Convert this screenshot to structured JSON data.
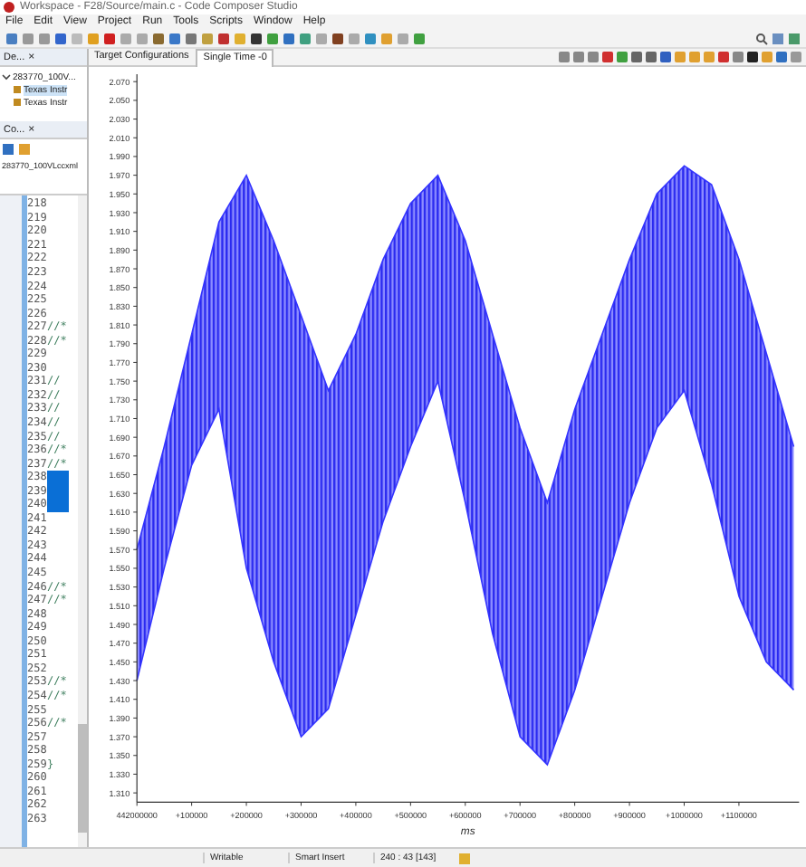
{
  "window": {
    "title": "Workspace - F28/Source/main.c - Code Composer Studio"
  },
  "menu": [
    "File",
    "Edit",
    "View",
    "Project",
    "Run",
    "Tools",
    "Scripts",
    "Window",
    "Help"
  ],
  "left_tab": {
    "label": "De...",
    "close": "×"
  },
  "tabs": [
    {
      "label": "Target Configurations",
      "selected": false
    },
    {
      "label": "Single Time -0",
      "selected": true
    }
  ],
  "debug_tree": [
    {
      "label": "283770_100V...",
      "expanded": true,
      "children": [
        {
          "label": "Texas Instr",
          "selected": true
        },
        {
          "label": "Texas Instr",
          "selected": false
        }
      ]
    }
  ],
  "console_panel": {
    "tab": "Co...",
    "close": "×",
    "text": "283770_100VLccxml"
  },
  "editor": {
    "lines": [
      {
        "number": "218",
        "selected": false
      },
      {
        "number": "219",
        "selected": false
      },
      {
        "number": "220",
        "selected": false
      },
      {
        "number": "221",
        "selected": false
      },
      {
        "number": "222",
        "selected": false
      },
      {
        "number": "223",
        "selected": false
      },
      {
        "number": "224",
        "selected": false
      },
      {
        "number": "225",
        "selected": false
      },
      {
        "number": "226",
        "selected": false
      },
      {
        "number": "227",
        "code": "//*",
        "selected": false
      },
      {
        "number": "228",
        "code": "//*",
        "selected": false
      },
      {
        "number": "229",
        "selected": false
      },
      {
        "number": "230",
        "selected": false
      },
      {
        "number": "231",
        "code": "//",
        "selected": false
      },
      {
        "number": "232",
        "code": "//",
        "selected": false
      },
      {
        "number": "233",
        "code": "//",
        "selected": false
      },
      {
        "number": "234",
        "code": "//",
        "selected": false
      },
      {
        "number": "235",
        "code": "//",
        "selected": false
      },
      {
        "number": "236",
        "code": "//*",
        "selected": false
      },
      {
        "number": "237",
        "code": "//*",
        "selected": false
      },
      {
        "number": "238",
        "selected": true
      },
      {
        "number": "239",
        "selected": true
      },
      {
        "number": "240",
        "selected": true
      },
      {
        "number": "241",
        "selected": false
      },
      {
        "number": "242",
        "selected": false
      },
      {
        "number": "243",
        "selected": false
      },
      {
        "number": "244",
        "selected": false
      },
      {
        "number": "245",
        "selected": false
      },
      {
        "number": "246",
        "code": "//*",
        "selected": false
      },
      {
        "number": "247",
        "code": "//*",
        "selected": false
      },
      {
        "number": "248",
        "selected": false
      },
      {
        "number": "249",
        "selected": false
      },
      {
        "number": "250",
        "selected": false
      },
      {
        "number": "251",
        "selected": false
      },
      {
        "number": "252",
        "selected": false
      },
      {
        "number": "253",
        "code": "//*",
        "selected": false
      },
      {
        "number": "254",
        "code": "//*",
        "selected": false
      },
      {
        "number": "255",
        "selected": false
      },
      {
        "number": "256",
        "code": "//*",
        "selected": false
      },
      {
        "number": "257",
        "selected": false
      },
      {
        "number": "258",
        "selected": false
      },
      {
        "number": "259",
        "code": "}",
        "selected": false
      },
      {
        "number": "260",
        "selected": false
      },
      {
        "number": "261",
        "selected": false
      },
      {
        "number": "262",
        "selected": false
      },
      {
        "number": "263",
        "selected": false
      }
    ]
  },
  "chart": {
    "chart_data": {
      "type": "area",
      "xlabel": "ms",
      "categories": [
        "442000000",
        null,
        "+100000",
        null,
        "+200000",
        null,
        "+300000",
        null,
        "+400000",
        null,
        "+500000",
        null,
        "+600000",
        null,
        "+700000",
        null,
        "+800000",
        null,
        "+900000",
        null,
        "+1000000",
        null,
        "+1100000",
        null,
        null
      ],
      "series": [
        {
          "color": "#3333ff",
          "values": [
            1.57,
            1.68,
            1.8,
            1.92,
            1.97,
            1.9,
            1.82,
            1.74,
            1.8,
            1.88,
            1.94,
            1.97,
            1.9,
            1.8,
            1.7,
            1.62,
            1.72,
            1.8,
            1.88,
            1.95,
            1.98,
            1.96,
            1.88,
            1.78,
            1.68
          ]
        },
        {
          "type": "line",
          "color": "#3333ff",
          "values": [
            1.43,
            1.55,
            1.66,
            1.72,
            1.55,
            1.45,
            1.37,
            1.4,
            1.5,
            1.6,
            1.68,
            1.75,
            1.62,
            1.48,
            1.37,
            1.34,
            1.42,
            1.52,
            1.62,
            1.7,
            1.74,
            1.64,
            1.52,
            1.45,
            1.42
          ]
        }
      ],
      "ylim": [
        1.3,
        2.078
      ],
      "yticks": [
        {
          "value": 1.31,
          "label": "1.310"
        },
        {
          "value": 1.33,
          "label": "1.330"
        },
        {
          "value": 1.35,
          "label": "1.350"
        },
        {
          "value": 1.37,
          "label": "1.370"
        },
        {
          "value": 1.39,
          "label": "1.390"
        },
        {
          "value": 1.41,
          "label": "1.410"
        },
        {
          "value": 1.43,
          "label": "1.430"
        },
        {
          "value": 1.45,
          "label": "1.450"
        },
        {
          "value": 1.47,
          "label": "1.470"
        },
        {
          "value": 1.49,
          "label": "1.490"
        },
        {
          "value": 1.51,
          "label": "1.510"
        },
        {
          "value": 1.53,
          "label": "1.530"
        },
        {
          "value": 1.55,
          "label": "1.550"
        },
        {
          "value": 1.57,
          "label": "1.570"
        },
        {
          "value": 1.59,
          "label": "1.590"
        },
        {
          "value": 1.61,
          "label": "1.610"
        },
        {
          "value": 1.63,
          "label": "1.630"
        },
        {
          "value": 1.65,
          "label": "1.650"
        },
        {
          "value": 1.67,
          "label": "1.670"
        },
        {
          "value": 1.69,
          "label": "1.690"
        },
        {
          "value": 1.71,
          "label": "1.710"
        },
        {
          "value": 1.73,
          "label": "1.730"
        },
        {
          "value": 1.75,
          "label": "1.750"
        },
        {
          "value": 1.77,
          "label": "1.770"
        },
        {
          "value": 1.79,
          "label": "1.790"
        },
        {
          "value": 1.81,
          "label": "1.810"
        },
        {
          "value": 1.83,
          "label": "1.830"
        },
        {
          "value": 1.85,
          "label": "1.850"
        },
        {
          "value": 1.87,
          "label": "1.870"
        },
        {
          "value": 1.89,
          "label": "1.890"
        },
        {
          "value": 1.91,
          "label": "1.910"
        },
        {
          "value": 1.93,
          "label": "1.930"
        },
        {
          "value": 1.95,
          "label": "1.950"
        },
        {
          "value": 1.97,
          "label": "1.970"
        },
        {
          "value": 1.99,
          "label": "1.990"
        },
        {
          "value": 2.01,
          "label": "2.010"
        },
        {
          "value": 2.03,
          "label": "2.030"
        },
        {
          "value": 2.05,
          "label": "2.050"
        },
        {
          "value": 2.07,
          "label": "2.070"
        }
      ]
    }
  },
  "status_bar": [
    "Writable",
    "Smart Insert",
    "240 : 43 [143]"
  ]
}
